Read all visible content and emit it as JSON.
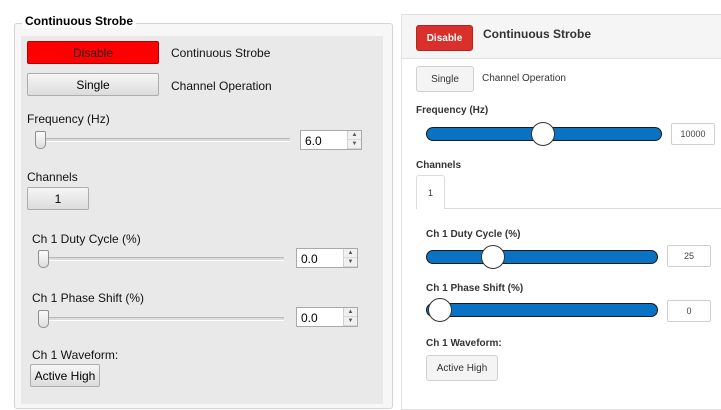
{
  "legacy": {
    "group_title": "Continuous Strobe",
    "strobe": {
      "button_label": "Disable",
      "label": "Continuous Strobe"
    },
    "channel_op": {
      "button_label": "Single",
      "label": "Channel Operation"
    },
    "frequency": {
      "label": "Frequency (Hz)",
      "value": "6.0",
      "level": 0.0
    },
    "channels": {
      "label": "Channels",
      "tab_label": "1"
    },
    "duty_cycle": {
      "label": "Ch 1 Duty Cycle (%)",
      "value": "0.0",
      "level": 0.0
    },
    "phase_shift": {
      "label": "Ch 1 Phase Shift (%)",
      "value": "0.0",
      "level": 0.0
    },
    "waveform": {
      "label": "Ch 1 Waveform:",
      "button_label": "Active High"
    }
  },
  "modern": {
    "title": "Continuous Strobe",
    "strobe": {
      "button_label": "Disable"
    },
    "channel_op": {
      "button_label": "Single",
      "label": "Channel Operation"
    },
    "frequency": {
      "label": "Frequency (Hz)",
      "value": "10000",
      "level": 0.5
    },
    "channels": {
      "label": "Channels",
      "tab_label": "1"
    },
    "duty_cycle": {
      "label": "Ch 1 Duty Cycle (%)",
      "value": "25",
      "level": 0.25
    },
    "phase_shift": {
      "label": "Ch 1 Phase Shift (%)",
      "value": "0",
      "level": 0.0
    },
    "waveform": {
      "label": "Ch 1 Waveform:",
      "button_label": "Active High"
    }
  },
  "colors": {
    "disable_red_legacy": "#ff0000",
    "disable_red_modern": "#d9302b",
    "slider_blue": "#0a72c2"
  }
}
